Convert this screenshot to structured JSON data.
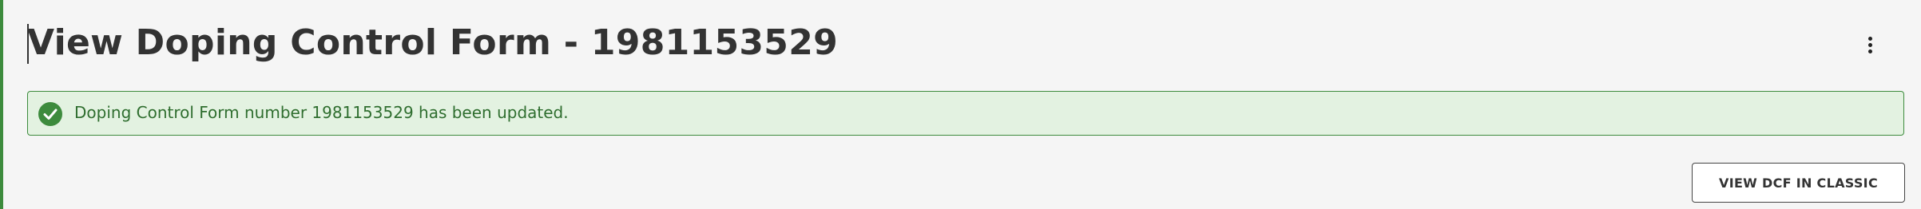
{
  "page": {
    "title": "View Doping Control Form - 1981153529"
  },
  "header": {
    "more_icon": "more-vertical-icon"
  },
  "alert": {
    "type": "success",
    "icon": "check-circle-icon",
    "message": "Doping Control Form number 1981153529 has been updated."
  },
  "actions": {
    "view_classic_label": "VIEW DCF IN CLASSIC"
  },
  "colors": {
    "page_background": "#f5f5f5",
    "success_green": "#3d8b3d",
    "success_background": "#e3f2e1",
    "success_text": "#2f6e2f",
    "title_text": "#333333"
  }
}
